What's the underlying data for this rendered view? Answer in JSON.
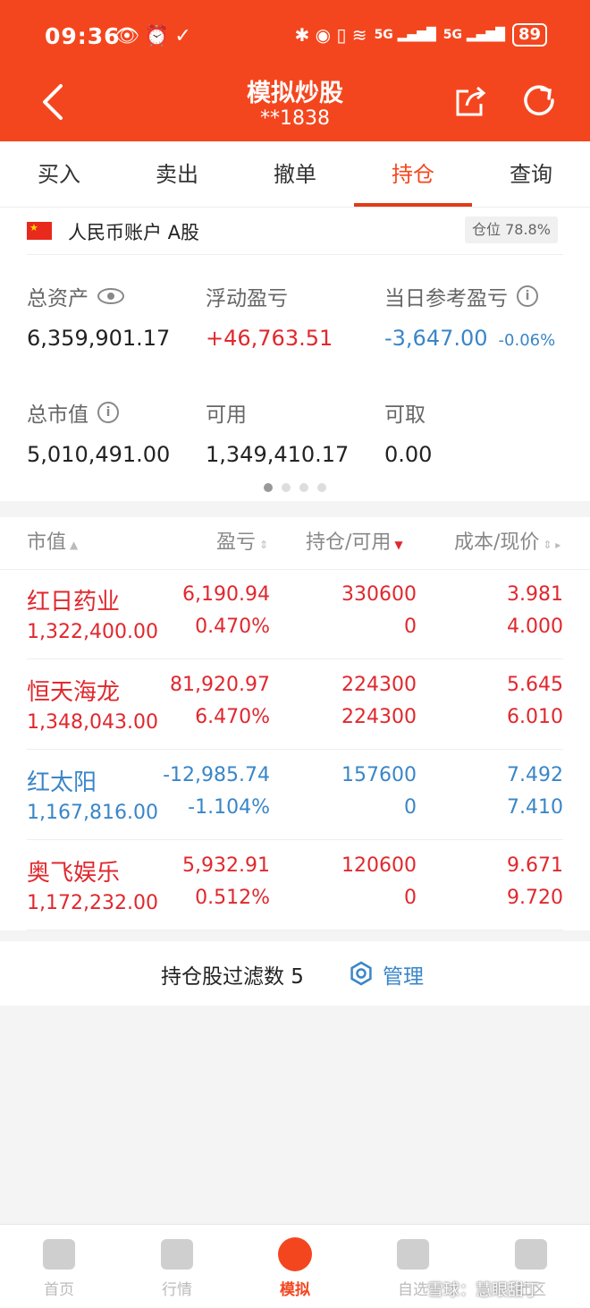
{
  "status_bar": {
    "time": "09:36",
    "left_icons": "👁⏰✓",
    "right_icons": "✱ ◉ ▯ ≋",
    "signal1": "5G ▂▄▆█",
    "signal2": "5G ▂▄▆█",
    "battery": "89"
  },
  "nav": {
    "title": "模拟炒股",
    "subtitle": "**1838"
  },
  "tabs": [
    {
      "label": "买入",
      "active": false
    },
    {
      "label": "卖出",
      "active": false
    },
    {
      "label": "撤单",
      "active": false
    },
    {
      "label": "持仓",
      "active": true
    },
    {
      "label": "查询",
      "active": false
    }
  ],
  "account": {
    "name": "人民币账户 A股",
    "position_badge": "仓位 78.8%"
  },
  "metrics": {
    "total_assets_label": "总资产",
    "total_assets": "6,359,901.17",
    "floating_pnl_label": "浮动盈亏",
    "floating_pnl": "+46,763.51",
    "daily_pnl_label": "当日参考盈亏",
    "daily_pnl": "-3,647.00",
    "daily_pnl_pct": "-0.06%",
    "market_value_label": "总市值",
    "market_value": "5,010,491.00",
    "available_label": "可用",
    "available": "1,349,410.17",
    "withdrawable_label": "可取",
    "withdrawable": "0.00"
  },
  "holdings": {
    "headers": {
      "market_value": "市值",
      "pnl": "盈亏",
      "hold_available": "持仓/可用",
      "cost_price": "成本/现价"
    },
    "rows": [
      {
        "name": "红日药业",
        "market_value": "1,322,400.00",
        "pnl": "6,190.94",
        "pnl_pct": "0.470%",
        "hold": "330600",
        "available": "0",
        "cost": "3.981",
        "price": "4.000",
        "color": "#e0282e"
      },
      {
        "name": "恒天海龙",
        "market_value": "1,348,043.00",
        "pnl": "81,920.97",
        "pnl_pct": "6.470%",
        "hold": "224300",
        "available": "224300",
        "cost": "5.645",
        "price": "6.010",
        "color": "#e0282e"
      },
      {
        "name": "红太阳",
        "market_value": "1,167,816.00",
        "pnl": "-12,985.74",
        "pnl_pct": "-1.104%",
        "hold": "157600",
        "available": "0",
        "cost": "7.492",
        "price": "7.410",
        "color": "#3a86c8"
      },
      {
        "name": "奥飞娱乐",
        "market_value": "1,172,232.00",
        "pnl": "5,932.91",
        "pnl_pct": "0.512%",
        "hold": "120600",
        "available": "0",
        "cost": "9.671",
        "price": "9.720",
        "color": "#e0282e"
      }
    ]
  },
  "filter": {
    "text": "持仓股过滤数 5",
    "manage_label": "管理"
  },
  "bottom_nav": [
    {
      "label": "首页",
      "active": false
    },
    {
      "label": "行情",
      "active": false
    },
    {
      "label": "模拟",
      "active": true
    },
    {
      "label": "自选",
      "active": false
    },
    {
      "label": "社区",
      "active": false
    }
  ],
  "watermark": "雪球：慧眼甜丁",
  "colors": {
    "brand": "#f4461e",
    "up": "#e0282e",
    "down": "#3a86c8"
  }
}
